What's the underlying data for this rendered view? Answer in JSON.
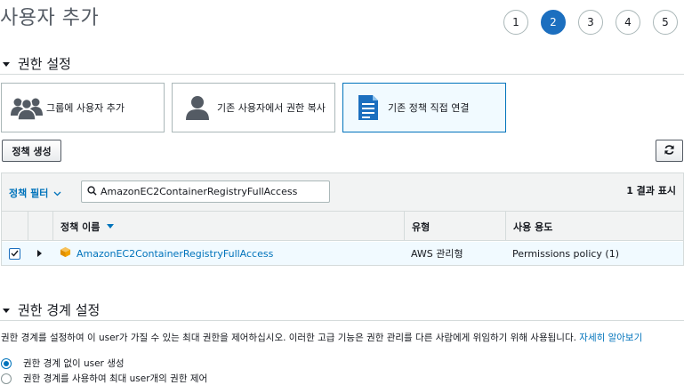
{
  "page": {
    "title": "사용자 추가"
  },
  "steps": [
    "1",
    "2",
    "3",
    "4",
    "5"
  ],
  "active_step": "2",
  "permissions": {
    "section_title": "권한 설정",
    "options": [
      {
        "label": "그룹에 사용자 추가",
        "icon": "users-group-icon",
        "selected": false
      },
      {
        "label": "기존 사용자에서 권한 복사",
        "icon": "user-icon",
        "selected": false
      },
      {
        "label": "기존 정책 직접 연결",
        "icon": "document-icon",
        "selected": true
      }
    ],
    "create_policy_label": "정책 생성",
    "refresh_icon": "refresh-icon"
  },
  "table": {
    "filter_label": "정책 필터",
    "search_value": "AmazonEC2ContainerRegistryFullAccess",
    "result_count": "1 결과 표시",
    "columns": {
      "name": "정책 이름",
      "type": "유형",
      "usage": "사용 용도"
    },
    "rows": [
      {
        "checked": true,
        "name": "AmazonEC2ContainerRegistryFullAccess",
        "type": "AWS 관리형",
        "usage": "Permissions policy (1)"
      }
    ]
  },
  "boundary": {
    "section_title": "권한 경계 설정",
    "description": "권한 경계를 설정하여 이 user가 가질 수 있는 최대 권한을 제어하십시오. 이러한 고급 기능은 권한 관리를 다른 사람에게 위임하기 위해 사용됩니다.",
    "learn_more": "자세히 알아보기",
    "options": [
      {
        "label": "권한 경계 없이 user 생성",
        "checked": true
      },
      {
        "label": "권한 경계를 사용하여 최대 user개의 권한 제어",
        "checked": false
      }
    ]
  },
  "colors": {
    "accent": "#0073bb",
    "active_step": "#1c6fbf",
    "policy_icon": "#f2a200"
  }
}
